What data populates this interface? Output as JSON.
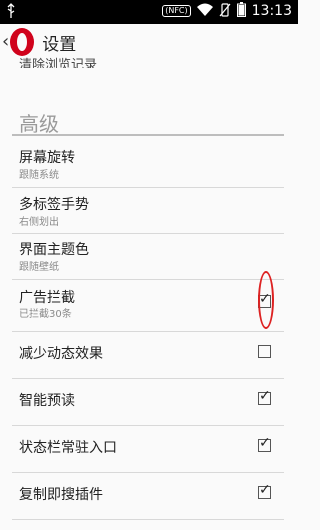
{
  "status_bar": {
    "nfc_label": "(NFC)",
    "time": "13:13"
  },
  "app_bar": {
    "title": "设置"
  },
  "partial_item": {
    "label": "清除浏览记录"
  },
  "section": {
    "title": "高级"
  },
  "items": [
    {
      "title": "屏幕旋转",
      "subtitle": "跟随系统"
    },
    {
      "title": "多标签手势",
      "subtitle": "右侧划出"
    },
    {
      "title": "界面主题色",
      "subtitle": "跟随壁纸"
    },
    {
      "title": "广告拦截",
      "subtitle": "已拦截30条",
      "checked": true
    },
    {
      "title": "减少动态效果",
      "checked": false
    },
    {
      "title": "智能预读",
      "checked": true
    },
    {
      "title": "状态栏常驻入口",
      "checked": true
    },
    {
      "title": "复制即搜插件",
      "checked": true
    }
  ],
  "colors": {
    "brand": "#d0021b",
    "annotation": "#dd2222",
    "status_bar": "#000000"
  },
  "icons": [
    "usb-icon",
    "nfc-icon",
    "wifi-icon",
    "vibrate-icon",
    "battery-icon",
    "back-chevron-icon",
    "opera-logo-icon"
  ]
}
